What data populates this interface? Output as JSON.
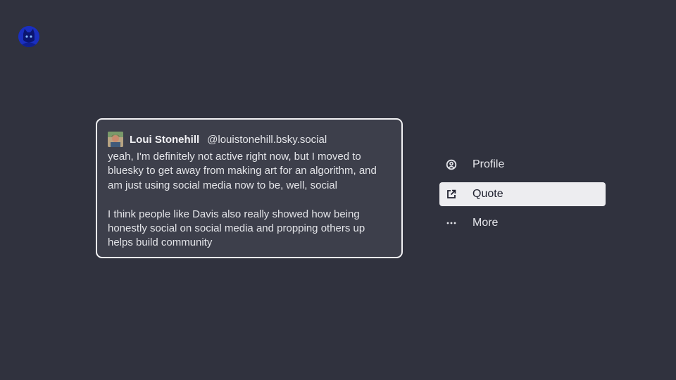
{
  "app": {
    "avatar_icon": "blue-cat-avatar-icon"
  },
  "post": {
    "author_name": "Loui Stonehill",
    "author_handle": "@louistonehill.bsky.social",
    "paragraphs": [
      "yeah, I'm definitely not active right now, but I moved to bluesky to get away from making art for an algorithm, and am just using social media now to be, well, social",
      "I think people like Davis also really showed how being honestly social on social media and propping others up helps build community"
    ]
  },
  "menu": {
    "items": [
      {
        "label": "Profile",
        "icon": "profile-icon",
        "selected": false
      },
      {
        "label": "Quote",
        "icon": "quote-external-icon",
        "selected": true
      },
      {
        "label": "More",
        "icon": "more-dots-icon",
        "selected": false
      }
    ]
  },
  "colors": {
    "background": "#30323e",
    "card": "#3d3f4b",
    "card_border": "#f2f2f4",
    "selected_item_bg": "#ededf0",
    "text": "#e3e4e8"
  }
}
